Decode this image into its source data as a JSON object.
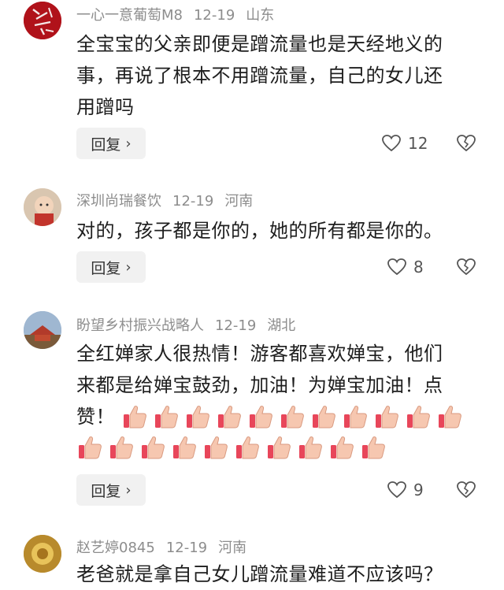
{
  "comments": [
    {
      "user": "一心一意葡萄M8",
      "date": "12-19",
      "location": "山东",
      "lines": [
        "全宝宝的父亲即便是蹭流量也是天经地义的",
        "事，再说了根本不用蹭流量，自己的女儿还",
        "用蹭吗"
      ],
      "reply_label": "回复",
      "likes": "12"
    },
    {
      "user": "深圳尚瑞餐饮",
      "date": "12-19",
      "location": "河南",
      "lines": [
        "对的，孩子都是你的，她的所有都是你的。"
      ],
      "reply_label": "回复",
      "likes": "8"
    },
    {
      "user": "盼望乡村振兴战略人",
      "date": "12-19",
      "location": "湖北",
      "lines": [
        "全红婵家人很热情！游客都喜欢婵宝，他们",
        "来都是给婵宝鼓劲，加油！为婵宝加油！点",
        "赞！"
      ],
      "reply_label": "回复",
      "likes": "9"
    },
    {
      "user": "赵艺婷0845",
      "date": "12-19",
      "location": "河南",
      "lines": [
        "老爸就是拿自己女儿蹭流量难道不应该吗？"
      ]
    }
  ]
}
